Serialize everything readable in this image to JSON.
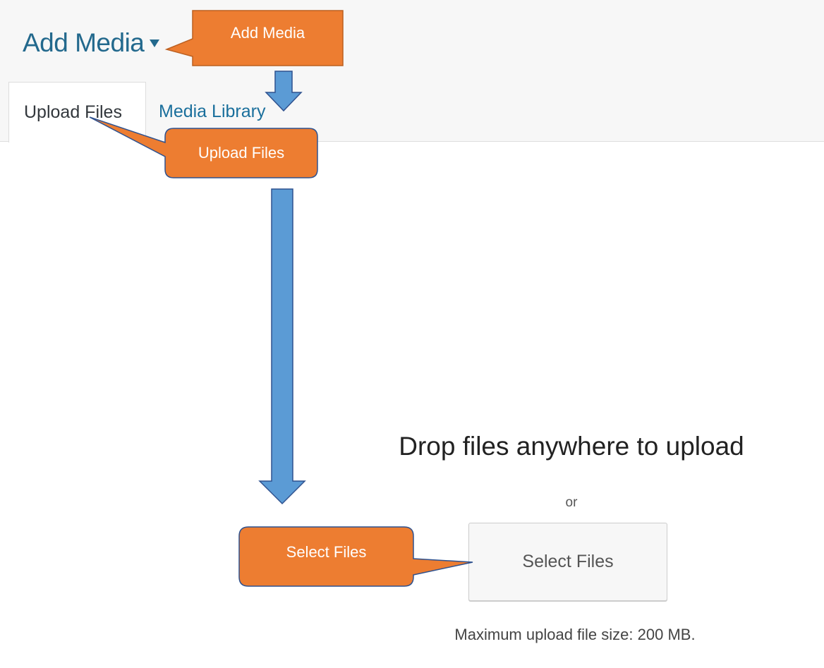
{
  "header": {
    "title": "Add Media",
    "tabs": [
      {
        "label": "Upload Files",
        "active": true
      },
      {
        "label": "Media Library",
        "active": false
      }
    ]
  },
  "upload": {
    "heading": "Drop files anywhere to upload",
    "separator": "or",
    "select_button_label": "Select Files",
    "max_size_note": "Maximum upload file size: 200 MB."
  },
  "annotations": {
    "callouts": [
      {
        "label": "Add Media"
      },
      {
        "label": "Upload Files"
      },
      {
        "label": "Select Files"
      }
    ],
    "callout_color": "#ed7d31",
    "callout_border": "#bc6021",
    "arrow_color": "#5b9bd5",
    "arrow_border": "#2f528f"
  },
  "colors": {
    "title": "#23698d",
    "link": "#1a6f9c",
    "header_bg": "#f7f7f7",
    "button_bg": "#f7f7f7"
  }
}
